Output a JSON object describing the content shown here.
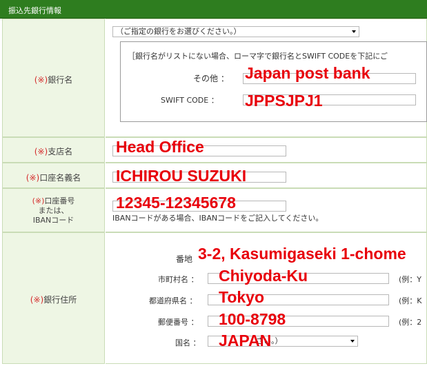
{
  "header": {
    "title": "振込先銀行情報"
  },
  "required_mark": "(※)",
  "bank": {
    "label": "銀行名",
    "select_text": "（ご指定の銀行をお選びください。）",
    "note": "［銀行名がリストにない場合、ローマ字で銀行名とSWIFT CODEを下記にご",
    "other_label": "その他 ：",
    "swift_label": "SWIFT CODE ：",
    "other_value": "Japan post bank",
    "swift_value": "JPPSJPJ1"
  },
  "branch": {
    "label": "支店名",
    "value": "Head Office"
  },
  "account_name": {
    "label": "口座名義名",
    "value": "ICHIROU SUZUKI"
  },
  "account_number": {
    "label_line1": "口座番号",
    "label_line2": "または、",
    "label_line3": "IBANコード",
    "value": "12345-12345678",
    "help": "IBANコードがある場合、IBANコードをご記入してください。"
  },
  "address": {
    "label": "銀行住所",
    "street_label": "番地",
    "city_label": "市町村名 ：",
    "prefecture_label": "都道府県名 ：",
    "postal_label": "郵便番号 ：",
    "country_label": "国名 ：",
    "street_value": "3-2, Kasumigaseki 1-chome",
    "city_value": "Chiyoda-Ku",
    "prefecture_value": "Tokyo",
    "postal_value": "100-8798",
    "country_value": "JAPAN",
    "country_select_tail": "さい。）",
    "city_example": "(例：Y",
    "prefecture_example": "(例：K",
    "postal_example": "(例：2"
  }
}
